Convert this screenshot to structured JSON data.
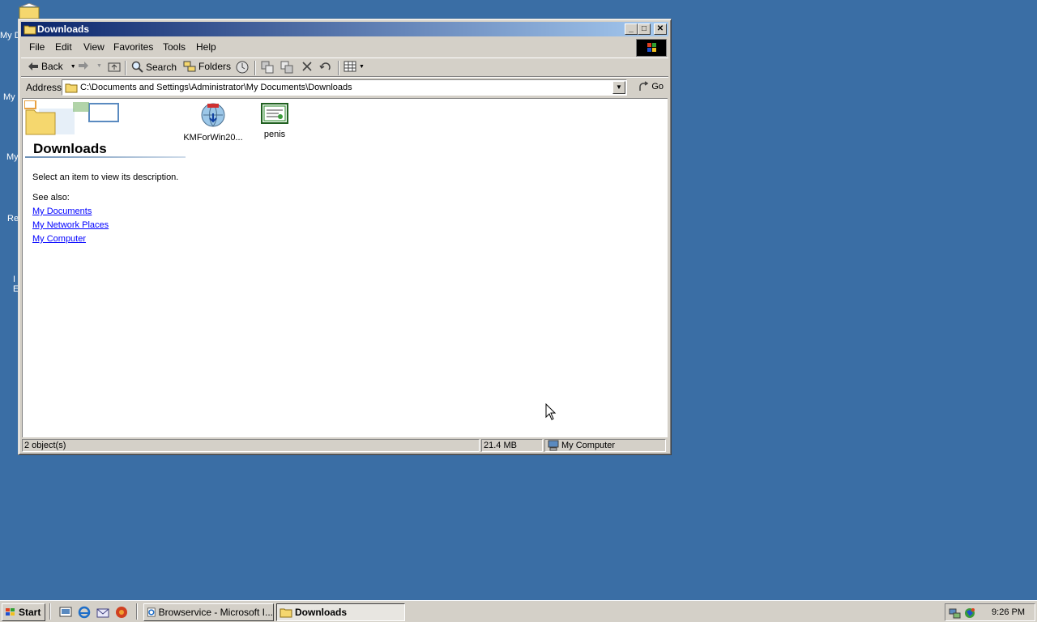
{
  "desktop": {
    "partial_icon_labels": [
      "My D",
      "My",
      "My",
      "Re",
      "I",
      "E"
    ]
  },
  "window": {
    "title": "Downloads",
    "controls": {
      "minimize": "_",
      "maximize": "□",
      "close": "✕"
    }
  },
  "menubar": {
    "items": [
      "File",
      "Edit",
      "View",
      "Favorites",
      "Tools",
      "Help"
    ]
  },
  "toolbar": {
    "back_label": "Back",
    "search_label": "Search",
    "folders_label": "Folders"
  },
  "address": {
    "label": "Address",
    "path": "C:\\Documents and Settings\\Administrator\\My Documents\\Downloads",
    "go_label": "Go"
  },
  "sidebar": {
    "title": "Downloads",
    "description": "Select an item to view its description.",
    "see_also": "See also:",
    "links": [
      "My Documents",
      "My Network Places",
      "My Computer"
    ]
  },
  "files": [
    {
      "name": "KMForWin20...",
      "icon": "installer-globe-icon"
    },
    {
      "name": "penis",
      "icon": "certificate-icon"
    }
  ],
  "status": {
    "objects": "2 object(s)",
    "size": "21.4 MB",
    "zone": "My Computer"
  },
  "taskbar": {
    "start_label": "Start",
    "tasks": [
      "Browservice - Microsoft I...",
      "Downloads"
    ],
    "clock": "9:26 PM"
  },
  "colors": {
    "desktop": "#3A6EA5",
    "title_gradient_start": "#0A246A",
    "title_gradient_end": "#A6CAF0",
    "chrome": "#D4D0C8",
    "link": "#0000FF"
  }
}
